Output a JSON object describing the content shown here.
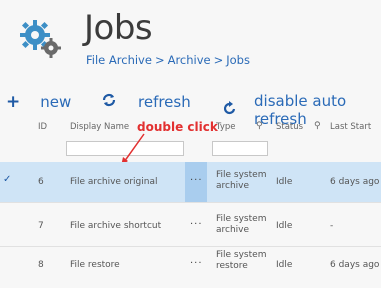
{
  "page": {
    "title": "Jobs",
    "breadcrumb": [
      "File Archive",
      "Archive",
      "Jobs"
    ],
    "breadcrumb_separator": ">"
  },
  "toolbar": {
    "new_label": "new",
    "refresh_label": "refresh",
    "disable_auto_refresh_label": "disable auto refresh"
  },
  "grid": {
    "headers": {
      "id": "ID",
      "display_name": "Display Name",
      "type": "Type",
      "status": "Status",
      "last_start": "Last Start"
    },
    "rows": [
      {
        "id": "6",
        "name": "File archive original",
        "more": "···",
        "type": "File system\narchive",
        "status": "Idle",
        "last_start": "6 days ago",
        "selected": true
      },
      {
        "id": "7",
        "name": "File archive shortcut",
        "more": "···",
        "type": "File system\narchive",
        "status": "Idle",
        "last_start": "-",
        "selected": false
      },
      {
        "id": "8",
        "name": "File restore",
        "more": "···",
        "type": "File system\nrestore",
        "status": "Idle",
        "last_start": "6 days ago",
        "selected": false
      }
    ]
  },
  "annotation": {
    "text": "double click",
    "color": "#e23030"
  },
  "icons": {
    "header": "gears-icon",
    "new": "plus-icon",
    "refresh": "refresh-icon",
    "disable_auto_refresh": "auto-refresh-icon",
    "filter": "pin-icon",
    "selected": "check-icon"
  },
  "colors": {
    "accent": "#2a6ab7",
    "selected_row": "#cfe4f6",
    "selected_more": "#a9cdee"
  }
}
